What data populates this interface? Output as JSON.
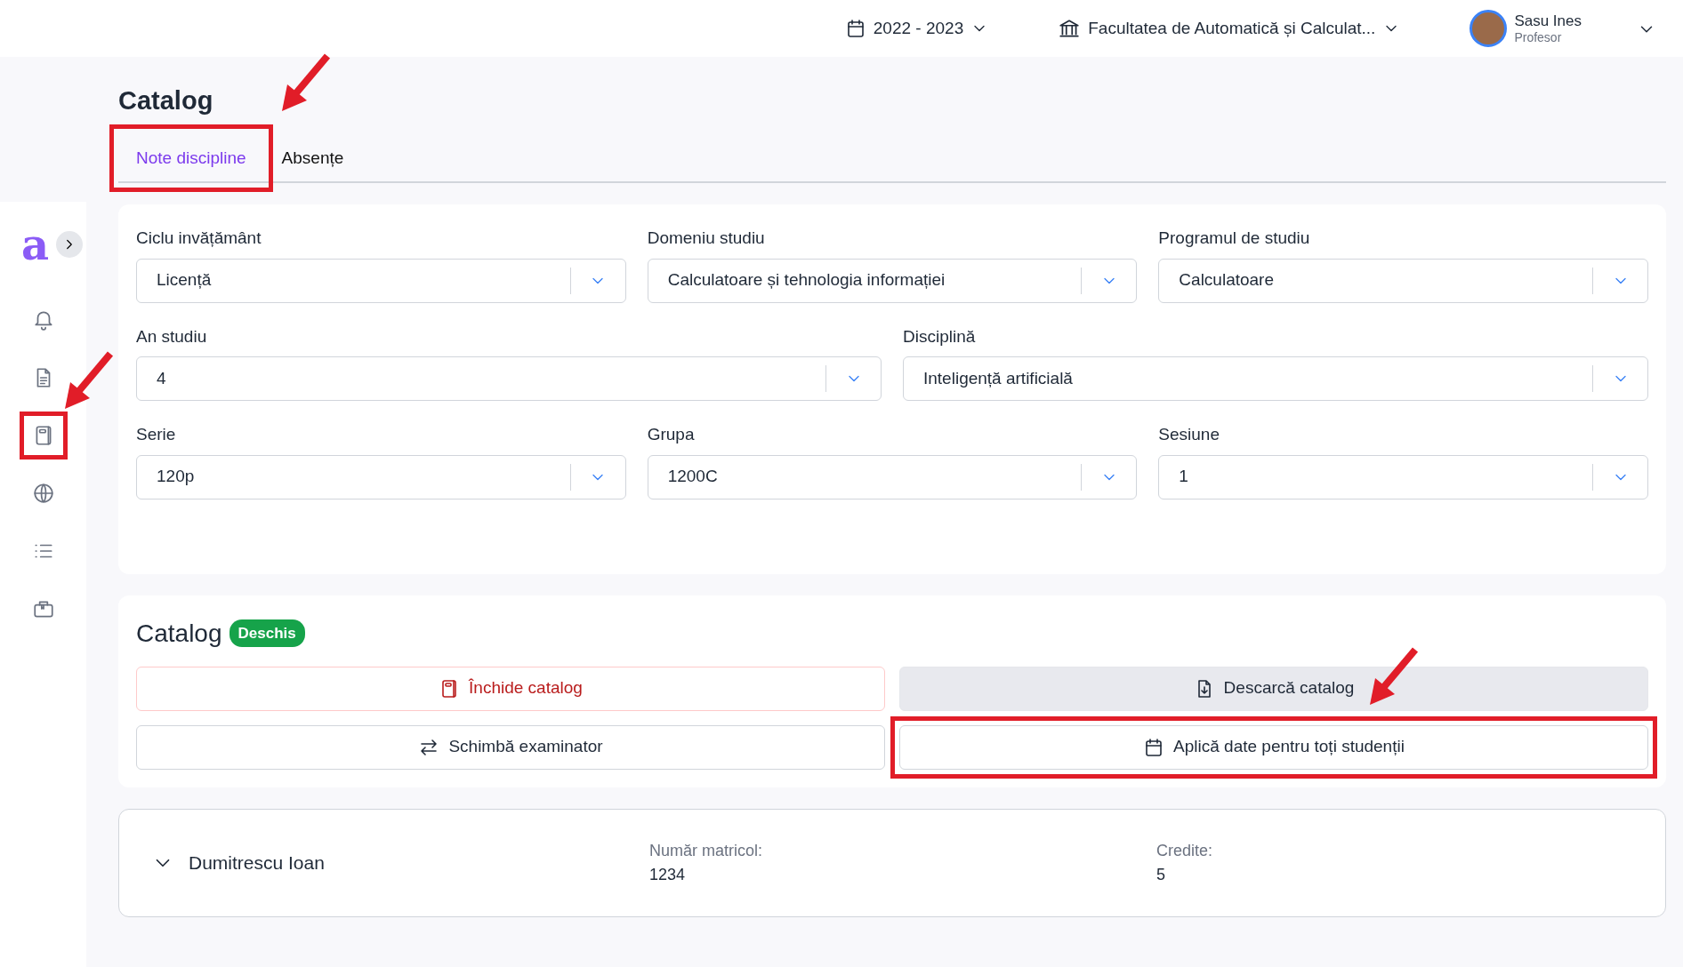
{
  "topbar": {
    "year": "2022 - 2023",
    "faculty": "Facultatea de Automatică și Calculat...",
    "user": {
      "name": "Sasu Ines",
      "role": "Profesor"
    }
  },
  "sidebar": {
    "logo": "a",
    "items": [
      {
        "highlighted": false
      },
      {
        "highlighted": false
      },
      {
        "highlighted": true
      },
      {
        "highlighted": false
      },
      {
        "highlighted": false
      },
      {
        "highlighted": false
      }
    ]
  },
  "page_title": "Catalog",
  "tabs": [
    {
      "label": "Note discipline",
      "selected": true,
      "highlighted": true
    },
    {
      "label": "Absențe",
      "selected": false,
      "highlighted": false
    }
  ],
  "filters": [
    [
      {
        "label": "Ciclu invățământ",
        "value": "Licență"
      },
      {
        "label": "Domeniu studiu",
        "value": "Calculatoare și tehnologia informației"
      },
      {
        "label": "Programul de studiu",
        "value": "Calculatoare"
      }
    ],
    [
      {
        "label": "An studiu",
        "value": "4"
      },
      {
        "label": "Disciplină",
        "value": "Inteligență artificială"
      }
    ],
    [
      {
        "label": "Serie",
        "value": "120p"
      },
      {
        "label": "Grupa",
        "value": "1200C"
      },
      {
        "label": "Sesiune",
        "value": "1"
      }
    ]
  ],
  "catalog": {
    "title": "Catalog",
    "status": "Deschis",
    "buttons": [
      {
        "label": "Închide catalog",
        "kind": "danger",
        "highlighted": false
      },
      {
        "label": "Descarcă catalog",
        "kind": "secondary",
        "highlighted": false
      },
      {
        "label": "Schimbă examinator",
        "kind": "outline",
        "highlighted": false
      },
      {
        "label": "Aplică date pentru toți studenții",
        "kind": "outline",
        "highlighted": true
      }
    ]
  },
  "students": [
    {
      "name": "Dumitrescu Ioan",
      "expanded": false,
      "id_label": "Număr matricol:",
      "id": "1234",
      "credits_label": "Credite:",
      "credits": "5"
    }
  ]
}
